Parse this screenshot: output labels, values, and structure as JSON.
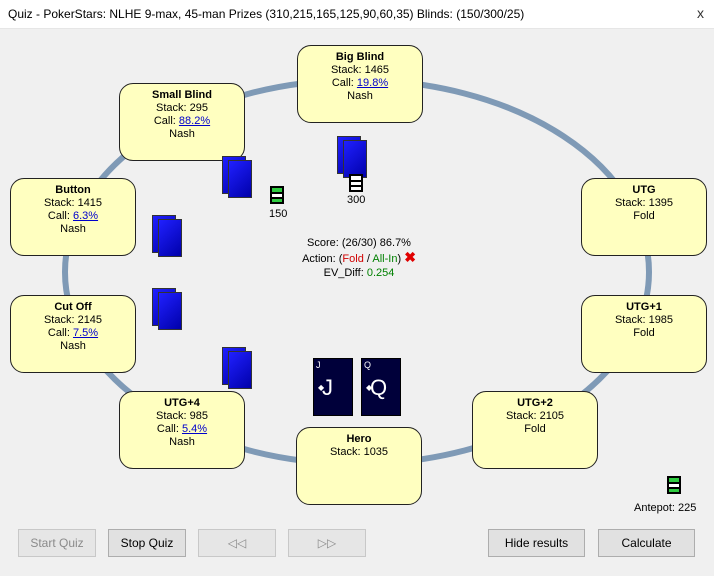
{
  "window": {
    "title": "Quiz - PokerStars: NLHE 9-max, 45-man Prizes (310,215,165,125,90,60,35) Blinds: (150/300/25)",
    "close_glyph": "x"
  },
  "seats": {
    "big_blind": {
      "name": "Big Blind",
      "stack": "Stack: 1465",
      "call_prefix": "Call: ",
      "call_value": "19.8%",
      "status": "Nash"
    },
    "small_blind": {
      "name": "Small Blind",
      "stack": "Stack: 295",
      "call_prefix": "Call: ",
      "call_value": "88.2%",
      "status": "Nash"
    },
    "button": {
      "name": "Button",
      "stack": "Stack: 1415",
      "call_prefix": "Call: ",
      "call_value": "6.3%",
      "status": "Nash"
    },
    "cut_off": {
      "name": "Cut Off",
      "stack": "Stack: 2145",
      "call_prefix": "Call: ",
      "call_value": "7.5%",
      "status": "Nash"
    },
    "utg4": {
      "name": "UTG+4",
      "stack": "Stack: 985",
      "call_prefix": "Call: ",
      "call_value": "5.4%",
      "status": "Nash"
    },
    "hero": {
      "name": "Hero",
      "stack": "Stack: 1035"
    },
    "utg2": {
      "name": "UTG+2",
      "stack": "Stack: 2105",
      "status": "Fold"
    },
    "utg1": {
      "name": "UTG+1",
      "stack": "Stack: 1985",
      "status": "Fold"
    },
    "utg": {
      "name": "UTG",
      "stack": "Stack: 1395",
      "status": "Fold"
    }
  },
  "bets": {
    "small_blind": "150",
    "big_blind": "300"
  },
  "result": {
    "score": "Score: (26/30) 86.7%",
    "action_prefix": "Action: (",
    "action_fold": "Fold",
    "action_sep": " / ",
    "action_allin": "All-In",
    "action_suffix": ")",
    "ev_label": "EV_Diff: ",
    "ev_value": "0.254",
    "wrong_glyph": "✖"
  },
  "hero_cards": [
    {
      "corner": "J",
      "rank": "J",
      "pip": "◆"
    },
    {
      "corner": "Q",
      "rank": "Q",
      "pip": "◆"
    }
  ],
  "antepot": "Antepot: 225",
  "buttons": {
    "start": "Start Quiz",
    "stop": "Stop Quiz",
    "prev": "◁◁",
    "next": "▷▷",
    "hide": "Hide results",
    "calc": "Calculate"
  },
  "colors": {
    "seat_fill": "#ffffc0",
    "ring": "#7f9ab6",
    "card_blue": "#1a1aff",
    "hole_card": "#00003a"
  }
}
